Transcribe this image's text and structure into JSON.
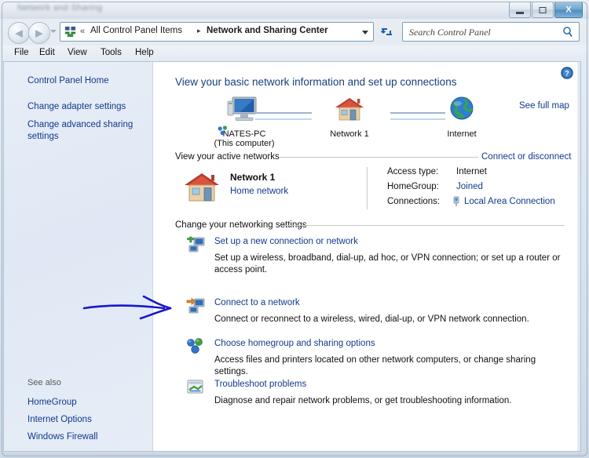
{
  "window": {
    "title": "Network and Sharing",
    "minimize_label": "Minimize",
    "maximize_label": "Maximize",
    "close_label": "X"
  },
  "nav": {
    "back_glyph": "◀",
    "forward_glyph": "▶",
    "breadcrumb_prefix": "«",
    "breadcrumb_1": "All Control Panel Items",
    "breadcrumb_separator": "▸",
    "breadcrumb_2": "Network and Sharing Center",
    "refresh_glyph": "↻",
    "search_placeholder": "Search Control Panel"
  },
  "menu": {
    "file": "File",
    "edit": "Edit",
    "view": "View",
    "tools": "Tools",
    "help": "Help"
  },
  "sidebar": {
    "links": [
      {
        "label": "Control Panel Home"
      },
      {
        "label": "Change adapter settings"
      },
      {
        "label": "Change advanced sharing settings"
      }
    ],
    "see_also_label": "See also",
    "see_also": [
      {
        "label": "HomeGroup"
      },
      {
        "label": "Internet Options"
      },
      {
        "label": "Windows Firewall"
      }
    ]
  },
  "main": {
    "heading": "View your basic network information and set up connections",
    "see_full_map": "See full map",
    "map": {
      "computer_name": "NATES-PC",
      "computer_sub": "(This computer)",
      "network_name": "Network 1",
      "internet_name": "Internet"
    },
    "active_networks": {
      "section_label": "View your active networks",
      "connect_link": "Connect or disconnect",
      "network_name": "Network 1",
      "network_type": "Home network",
      "access_type_key": "Access type:",
      "access_type_value": "Internet",
      "homegroup_key": "HomeGroup:",
      "homegroup_value": "Joined",
      "connections_key": "Connections:",
      "connections_value": "Local Area Connection"
    },
    "change_settings": {
      "section_label": "Change your networking settings",
      "tasks": [
        {
          "title": "Set up a new connection or network",
          "desc": "Set up a wireless, broadband, dial-up, ad hoc, or VPN connection; or set up a router or access point."
        },
        {
          "title": "Connect to a network",
          "desc": "Connect or reconnect to a wireless, wired, dial-up, or VPN network connection."
        },
        {
          "title": "Choose homegroup and sharing options",
          "desc": "Access files and printers located on other network computers, or change sharing settings."
        },
        {
          "title": "Troubleshoot problems",
          "desc": "Diagnose and repair network problems, or get troubleshooting information."
        }
      ]
    }
  },
  "annotation": {
    "type": "arrow",
    "color": "#1a18c8",
    "points_to": "connect-to-a-network-task"
  }
}
